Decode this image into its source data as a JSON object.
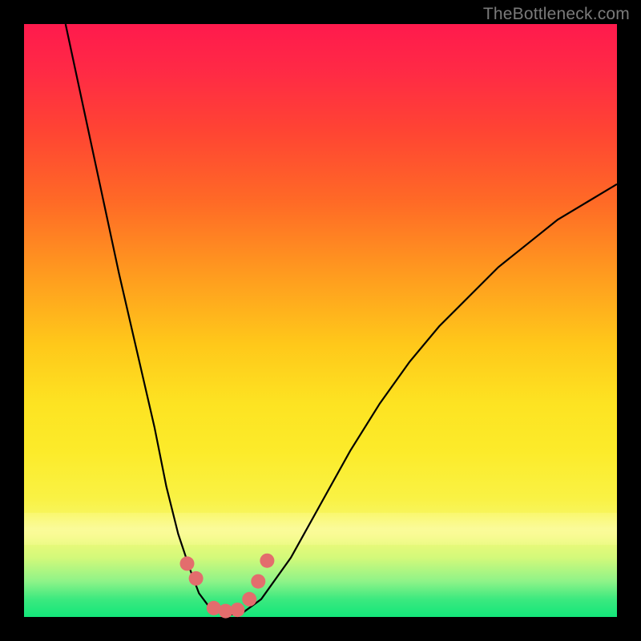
{
  "watermark": "TheBottleneck.com",
  "colors": {
    "frame": "#000000",
    "gradient_top": "#ff1a4d",
    "gradient_bottom": "#13e77a",
    "curve": "#000000",
    "markers": "#e36d6d"
  },
  "chart_data": {
    "type": "line",
    "title": "",
    "xlabel": "",
    "ylabel": "",
    "xlim": [
      0,
      100
    ],
    "ylim": [
      0,
      100
    ],
    "series": [
      {
        "name": "curve",
        "x": [
          7,
          10,
          13,
          16,
          19,
          22,
          24,
          26,
          28,
          29.5,
          31,
          33,
          35,
          37,
          40,
          45,
          50,
          55,
          60,
          65,
          70,
          75,
          80,
          85,
          90,
          95,
          100
        ],
        "y": [
          100,
          86,
          72,
          58,
          45,
          32,
          22,
          14,
          8,
          4,
          2,
          0.8,
          0.4,
          0.8,
          3,
          10,
          19,
          28,
          36,
          43,
          49,
          54,
          59,
          63,
          67,
          70,
          73
        ]
      }
    ],
    "markers": {
      "name": "bottom-points",
      "x": [
        27.5,
        29,
        32,
        34,
        36,
        38,
        39.5,
        41
      ],
      "y": [
        9,
        6.5,
        1.5,
        1,
        1.2,
        3,
        6,
        9.5
      ]
    }
  }
}
